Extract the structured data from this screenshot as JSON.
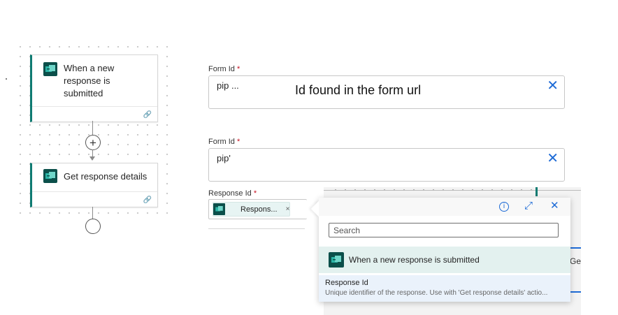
{
  "flow": {
    "trigger_card": {
      "title": "When a new response is submitted"
    },
    "action_card": {
      "title": "Get response details"
    }
  },
  "form_id_1": {
    "label": "Form Id",
    "required_mark": "*",
    "value": "pip ...",
    "annotation": "Id found in the form url"
  },
  "form_id_2": {
    "label": "Form Id",
    "required_mark": "*",
    "value": "pip'"
  },
  "response_id": {
    "label": "Response Id",
    "required_mark": "*",
    "token_label": "Respons...",
    "token_remove": "×"
  },
  "dynamic_content": {
    "search_placeholder": "Search",
    "group_title": "When a new response is submitted",
    "item_title": "Response Id",
    "item_description": "Unique identifier of the response. Use with 'Get response details' actio..."
  },
  "background_partial_text": "Ge",
  "icons": {
    "forms": "forms-icon",
    "link": "link-icon",
    "close": "close-icon",
    "info": "info-icon",
    "expand": "expand-icon",
    "add": "plus-icon"
  },
  "colors": {
    "accent_teal": "#0f7b72",
    "accent_blue": "#1e6bd6",
    "required_red": "#c50f1f",
    "icon_dark": "#0b4f4a"
  }
}
